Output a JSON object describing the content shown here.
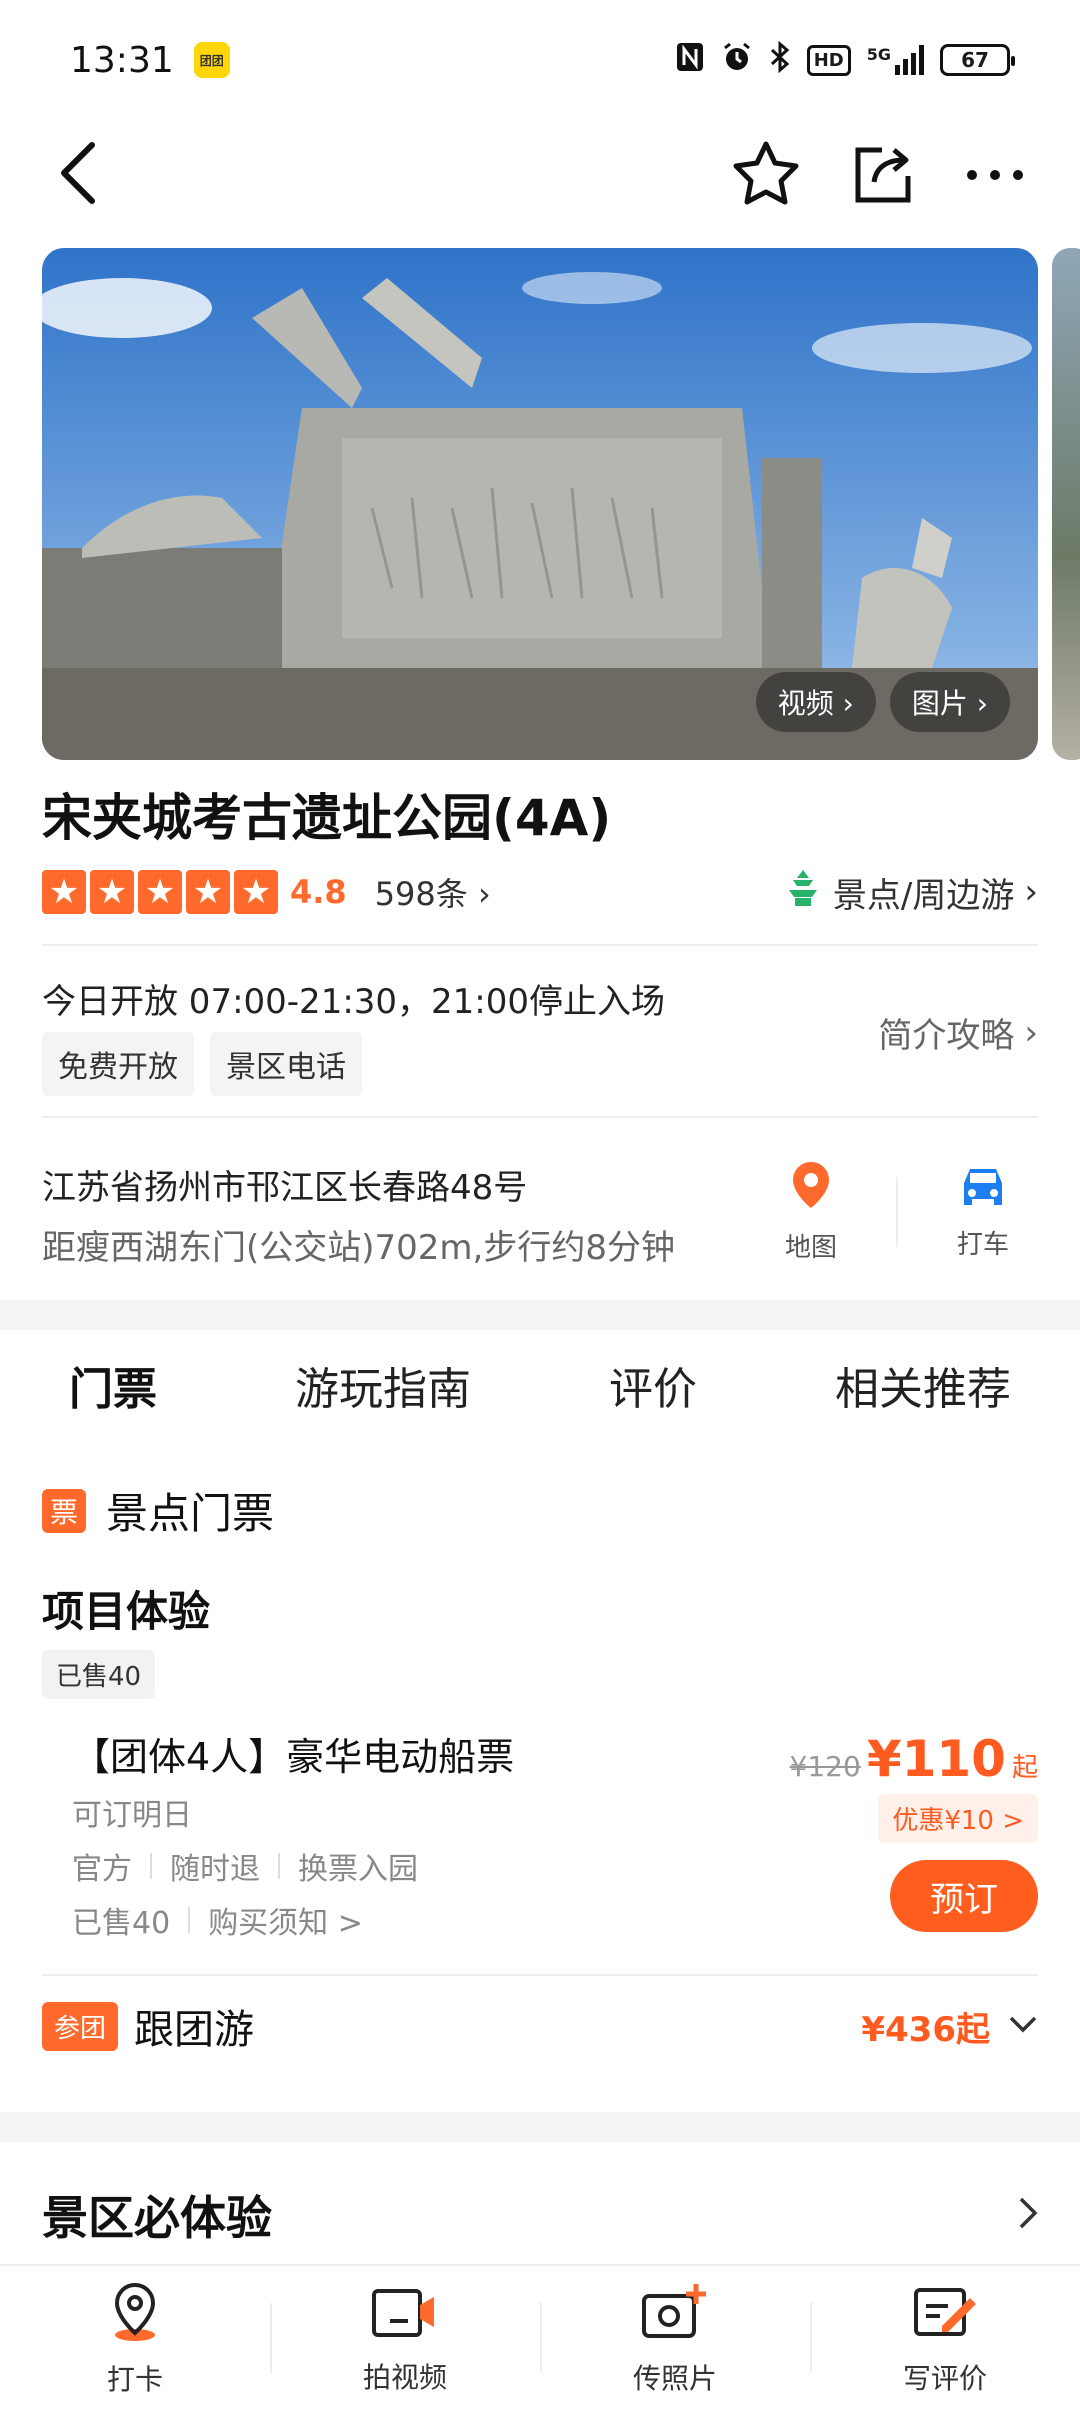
{
  "status_bar": {
    "time": "13:31",
    "app_badge": "团团",
    "icons": [
      "nfc-icon",
      "alarm-icon",
      "bluetooth-icon",
      "hd-icon",
      "5g-signal-icon"
    ],
    "hd": "HD",
    "network": "5G",
    "battery": "67"
  },
  "nav": {
    "back_icon": "back-chevron-icon",
    "favorite_icon": "star-outline-icon",
    "share_icon": "share-icon",
    "more_icon": "more-icon"
  },
  "gallery": {
    "video_label": "视频",
    "photo_label": "图片"
  },
  "attraction": {
    "title": "宋夹城考古遗址公园(4A)",
    "score": "4.8",
    "review_count": "598条",
    "category": "景点/周边游",
    "hours": "今日开放 07:00-21:30，21:00停止入场",
    "tags": [
      "免费开放",
      "景区电话"
    ],
    "intro_link": "简介攻略",
    "address": "江苏省扬州市邗江区长春路48号",
    "distance": "距瘦西湖东门(公交站)702m,步行约8分钟",
    "map_label": "地图",
    "taxi_label": "打车"
  },
  "tabs": [
    {
      "label": "门票",
      "active": true
    },
    {
      "label": "游玩指南",
      "active": false
    },
    {
      "label": "评价",
      "active": false
    },
    {
      "label": "相关推荐",
      "active": false
    }
  ],
  "tickets": {
    "badge": "票",
    "section_title": "景点门票",
    "subsection": "项目体验",
    "sold_tag": "已售40",
    "product": {
      "name": "【团体4人】豪华电动船票",
      "availability": "可订明日",
      "features": [
        "官方",
        "随时退",
        "换票入园"
      ],
      "sold": "已售40",
      "notice": "购买须知 >",
      "old_price": "¥120",
      "price": "¥110",
      "price_suffix": "起",
      "discount": "优惠¥10 >",
      "book_label": "预订"
    }
  },
  "group_tour": {
    "badge": "参团",
    "label": "跟团游",
    "price": "¥436起"
  },
  "must_experience": {
    "label": "景区必体验"
  },
  "bottom_bar": [
    {
      "label": "打卡",
      "icon": "location-pin-icon"
    },
    {
      "label": "拍视频",
      "icon": "video-camera-icon"
    },
    {
      "label": "传照片",
      "icon": "photo-upload-icon"
    },
    {
      "label": "写评价",
      "icon": "write-review-icon"
    }
  ],
  "colors": {
    "accent": "#ff5e1f",
    "category_green": "#27b36b",
    "map_icon": "#ff6a2c",
    "taxi_icon": "#1e7ef0"
  }
}
